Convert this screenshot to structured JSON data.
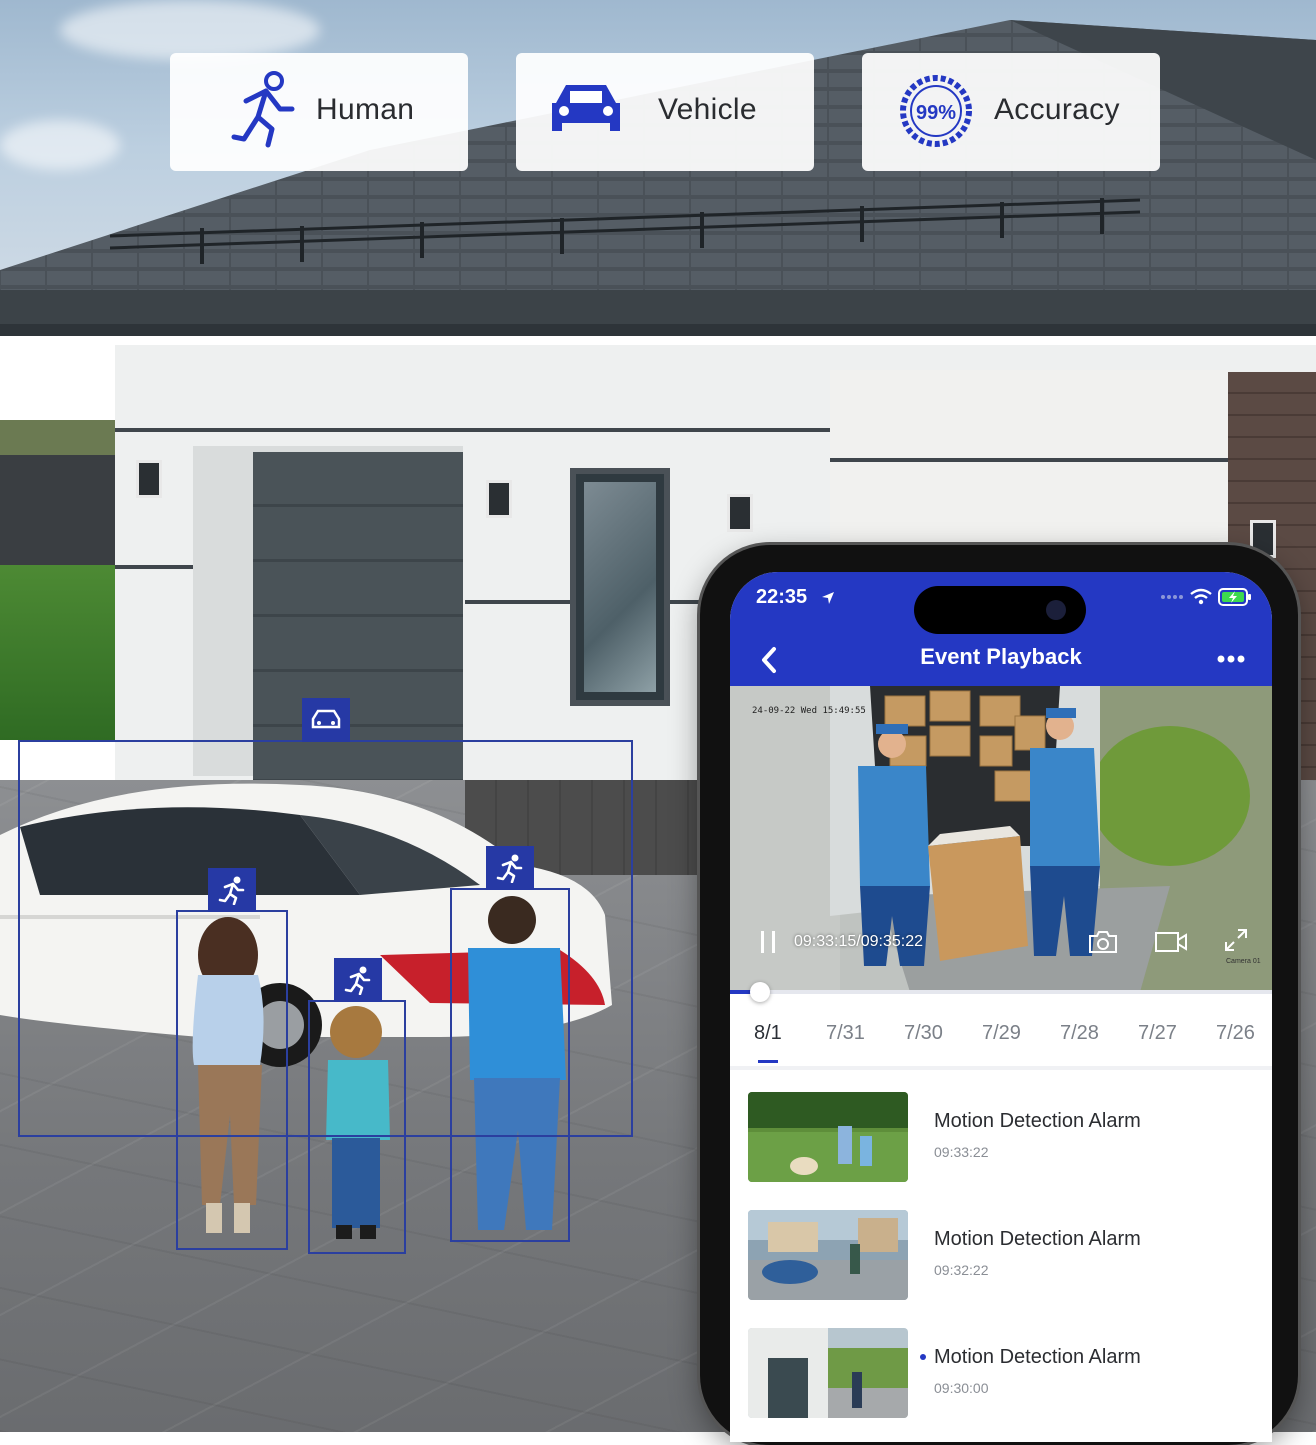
{
  "features": [
    {
      "label": "Human",
      "icon": "running-person-icon"
    },
    {
      "label": "Vehicle",
      "icon": "car-icon"
    },
    {
      "label": "Accuracy",
      "icon": "accuracy-gauge-icon",
      "badge_text": "99%"
    }
  ],
  "colors": {
    "accent": "#2438c3",
    "detection": "#2b3f9f"
  },
  "phone": {
    "status": {
      "time": "22:35"
    },
    "header": {
      "title": "Event Playback",
      "back_icon": "chevron-left-icon",
      "more_icon": "more-dots-icon"
    },
    "video": {
      "overlay_timestamp": "24-09-22 Wed 15:49:55",
      "playback_time": "09:33:15/09:35:22",
      "camera_label": "Camera 01",
      "progress": 0.04
    },
    "dates": [
      "8/1",
      "7/31",
      "7/30",
      "7/29",
      "7/28",
      "7/27",
      "7/26"
    ],
    "active_date": "8/1",
    "events": [
      {
        "title": "Motion Detection Alarm",
        "time": "09:33:22"
      },
      {
        "title": "Motion Detection Alarm",
        "time": "09:32:22"
      },
      {
        "title": "Motion Detection Alarm",
        "time": "09:30:00"
      }
    ]
  }
}
